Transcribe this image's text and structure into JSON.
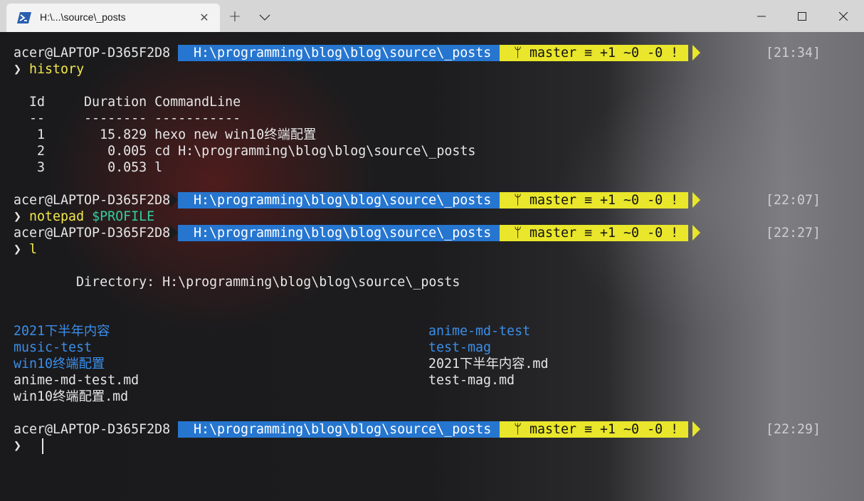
{
  "window": {
    "tab_title": "H:\\...\\source\\_posts",
    "tab_icon": "powershell-icon",
    "new_tab_icon": "+",
    "dropdown_icon": "∨",
    "close_icon": "✕",
    "minimize_icon": "—",
    "maximize_icon": "☐",
    "window_close_icon": "✕"
  },
  "colors": {
    "path_segment_bg": "#2676d0",
    "git_segment_bg": "#e9e62b",
    "command_text": "#f2e84b",
    "variable_text": "#2fd0a0",
    "directory_text": "#3b8eea"
  },
  "prompts": [
    {
      "user": "acer@LAPTOP-D365F2D8",
      "path": "H:\\programming\\blog\\blog\\source\\_posts",
      "git": "ᛘ master ≡ +1 ~0 -0 !",
      "time": "[21:34]"
    },
    {
      "user": "acer@LAPTOP-D365F2D8",
      "path": "H:\\programming\\blog\\blog\\source\\_posts",
      "git": "ᛘ master ≡ +1 ~0 -0 !",
      "time": "[22:07]"
    },
    {
      "user": "acer@LAPTOP-D365F2D8",
      "path": "H:\\programming\\blog\\blog\\source\\_posts",
      "git": "ᛘ master ≡ +1 ~0 -0 !",
      "time": "[22:27]"
    },
    {
      "user": "acer@LAPTOP-D365F2D8",
      "path": "H:\\programming\\blog\\blog\\source\\_posts",
      "git": "ᛘ master ≡ +1 ~0 -0 !",
      "time": "[22:29]"
    }
  ],
  "commands": {
    "chevron": "❯",
    "history": "history",
    "notepad": "notepad",
    "profile_var": "$PROFILE",
    "ls": "l"
  },
  "history_table": {
    "header": "  Id     Duration CommandLine",
    "divider": "  --     -------- -----------",
    "rows": [
      "   1       15.829 hexo new win10终端配置",
      "   2        0.005 cd H:\\programming\\blog\\blog\\source\\_posts",
      "   3        0.053 l"
    ]
  },
  "listing": {
    "directory_line": "        Directory: H:\\programming\\blog\\blog\\source\\_posts",
    "left_column": [
      {
        "name": "2021下半年内容",
        "kind": "dir"
      },
      {
        "name": "music-test",
        "kind": "dir"
      },
      {
        "name": "win10终端配置",
        "kind": "dir"
      },
      {
        "name": "anime-md-test.md",
        "kind": "file"
      },
      {
        "name": "win10终端配置.md",
        "kind": "file"
      }
    ],
    "right_column": [
      {
        "name": "anime-md-test",
        "kind": "dir"
      },
      {
        "name": "test-mag",
        "kind": "dir"
      },
      {
        "name": "2021下半年内容.md",
        "kind": "file"
      },
      {
        "name": "test-mag.md",
        "kind": "file"
      }
    ]
  }
}
